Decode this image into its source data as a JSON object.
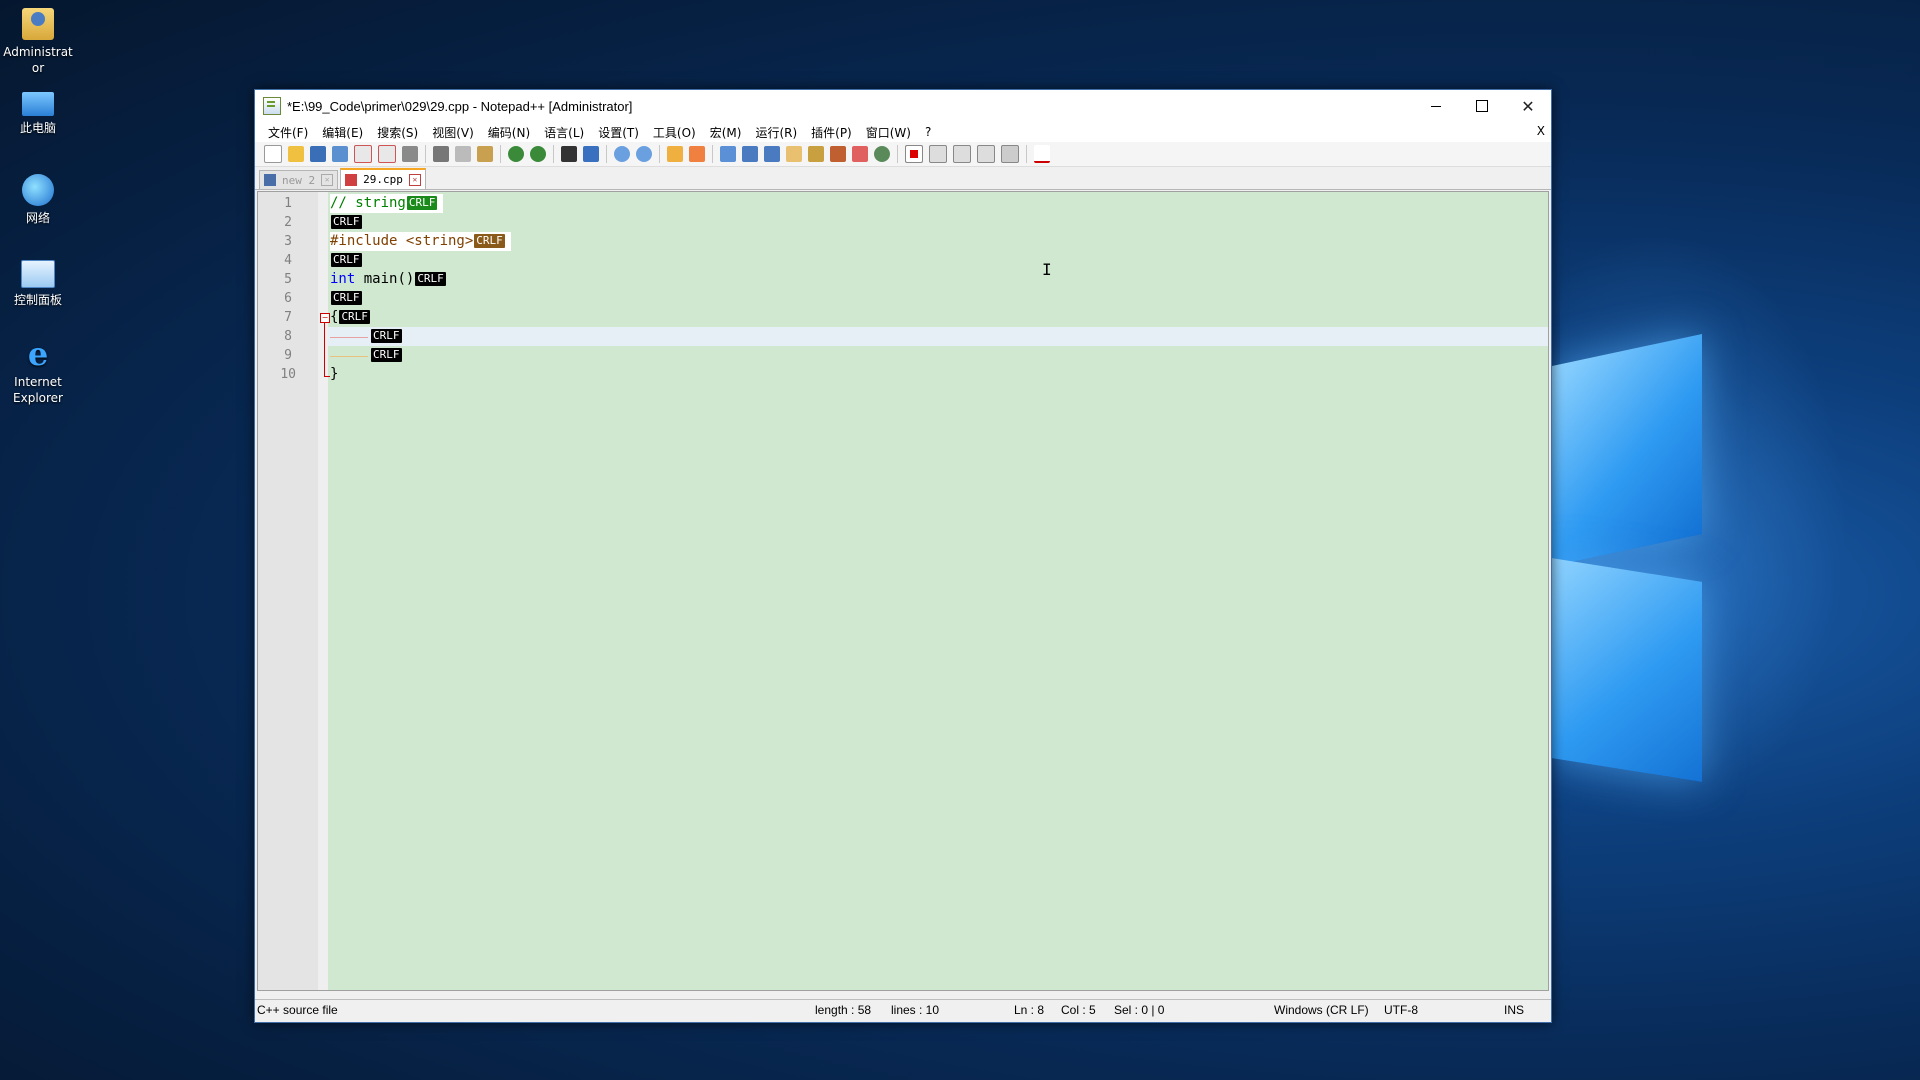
{
  "desktop": {
    "icons": [
      {
        "label": "Administrat or",
        "icon": "user-folder-icon"
      },
      {
        "label": "此电脑",
        "icon": "computer-icon"
      },
      {
        "label": "网络",
        "icon": "network-icon"
      },
      {
        "label": "控制面板",
        "icon": "control-panel-icon"
      },
      {
        "label": "Internet Explorer",
        "icon": "internet-explorer-icon"
      }
    ]
  },
  "window": {
    "title": "*E:\\99_Code\\primer\\029\\29.cpp - Notepad++ [Administrator]",
    "controls": {
      "minimize": "minimize-icon",
      "maximize": "maximize-icon",
      "close": "✕"
    }
  },
  "menu": {
    "items": [
      "文件(F)",
      "编辑(E)",
      "搜索(S)",
      "视图(V)",
      "编码(N)",
      "语言(L)",
      "设置(T)",
      "工具(O)",
      "宏(M)",
      "运行(R)",
      "插件(P)",
      "窗口(W)",
      "?"
    ],
    "close": "X"
  },
  "tabs": [
    {
      "label": "new 2",
      "active": false
    },
    {
      "label": "29.cpp",
      "active": true
    }
  ],
  "editor": {
    "line_numbers": [
      "1",
      "2",
      "3",
      "4",
      "5",
      "6",
      "7",
      "8",
      "9",
      "10"
    ],
    "eol_marker": "CRLF",
    "lines": [
      {
        "text": "// string"
      },
      {
        "text": ""
      },
      {
        "text": "#include <string>"
      },
      {
        "text": ""
      },
      {
        "kw": "int",
        "text": " main()"
      },
      {
        "text": ""
      },
      {
        "text": "{"
      },
      {
        "text": ""
      },
      {
        "text": ""
      },
      {
        "text": "}"
      }
    ],
    "current_line": 8,
    "colors": {
      "background": "#cfe8cf",
      "current_line": "#e6eef6"
    }
  },
  "status": {
    "filetype": "C++ source file",
    "length": "length : 58",
    "lines": "lines : 10",
    "ln": "Ln : 8",
    "col": "Col : 5",
    "sel": "Sel : 0 | 0",
    "eol": "Windows (CR LF)",
    "encoding": "UTF-8",
    "mode": "INS"
  }
}
